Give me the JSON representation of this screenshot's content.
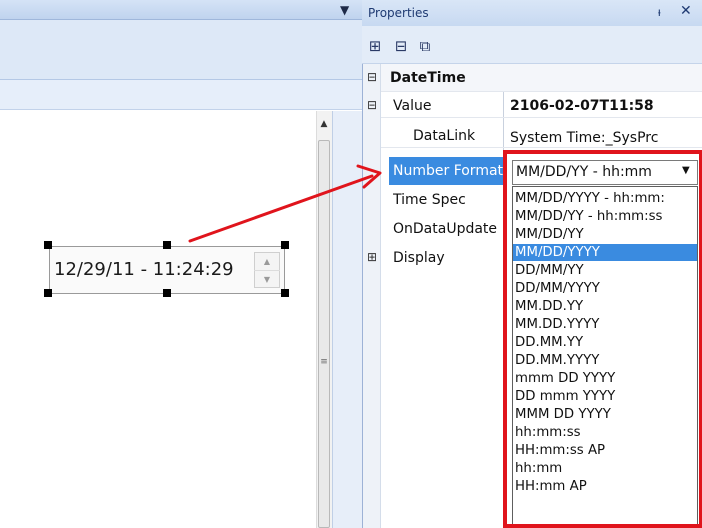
{
  "designer": {
    "date_display": "12/29/11 - 11:24:29"
  },
  "properties": {
    "title": "Properties",
    "pin_glyph": "📌",
    "close_glyph": "✕",
    "toolbar_icons": [
      "categorized-icon",
      "alphabetical-icon",
      "property-pages-icon"
    ],
    "category": "DateTime",
    "rows": [
      {
        "name": "Value",
        "value": "2106-02-07T11:58",
        "expander": "−"
      },
      {
        "name": "DataLink",
        "value": "System Time:_SysPrc",
        "expander": ""
      },
      {
        "name": "Number Format",
        "value": "MM/DD/YY - hh:mm",
        "expander": ""
      },
      {
        "name": "Time Spec",
        "value": "",
        "expander": ""
      },
      {
        "name": "OnDataUpdate",
        "value": "",
        "expander": ""
      },
      {
        "name": "Display",
        "value": "",
        "expander": "+"
      }
    ]
  },
  "dropdown": {
    "selected_index": 3,
    "options": [
      "MM/DD/YYYY - hh:mm:",
      "MM/DD/YY - hh:mm:ss",
      "MM/DD/YY",
      "MM/DD/YYYY",
      "DD/MM/YY",
      "DD/MM/YYYY",
      "MM.DD.YY",
      "MM.DD.YYYY",
      "DD.MM.YY",
      "DD.MM.YYYY",
      "mmm DD YYYY",
      "DD mmm YYYY",
      "MMM DD YYYY",
      "hh:mm:ss",
      "HH:mm:ss AP",
      "hh:mm",
      "HH:mm AP"
    ]
  },
  "colors": {
    "highlight": "#3a8be0",
    "annotation_red": "#e0141c"
  }
}
